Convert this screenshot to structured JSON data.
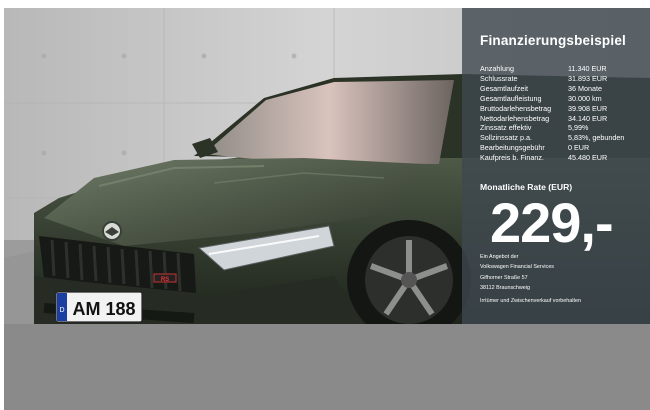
{
  "panel": {
    "title": "Finanzierungsbeispiel",
    "specs": [
      {
        "label": "Anzahlung",
        "value": "11.340 EUR"
      },
      {
        "label": "Schlussrate",
        "value": "31.893 EUR"
      },
      {
        "label": "Gesamtlaufzeit",
        "value": "36 Monate"
      },
      {
        "label": "Gesamtlaufleistung",
        "value": "30.000 km"
      },
      {
        "label": "Bruttodarlehensbetrag",
        "value": "39.908 EUR"
      },
      {
        "label": "Nettodarlehensbetrag",
        "value": "34.140 EUR"
      },
      {
        "label": "Zinssatz effektiv",
        "value": "5,99%"
      },
      {
        "label": "Sollzinssatz p.a.",
        "value": "5,83%, gebunden"
      },
      {
        "label": "Bearbeitungsgebühr",
        "value": "0 EUR"
      },
      {
        "label": "Kaufpreis b. Finanz.",
        "value": "45.480 EUR"
      }
    ],
    "rate_label": "Monatliche Rate (EUR)",
    "rate_value": "229,-",
    "offer_lines": [
      "Ein Angebot der",
      "Volkswagen Financial Services",
      "Gifhorner Straße 57",
      "38112 Braunschweig"
    ],
    "disclaimer": "Irrtümer und Zwischenverkauf vorbehalten"
  },
  "car": {
    "plate_country": "D",
    "plate_text": "AM 188",
    "badge_text": "RS"
  },
  "colors": {
    "panel_bg": "#3e4850",
    "car_body": "#3a4434",
    "wall": "#c9c9c9",
    "bottom_band": "#8a8a8a"
  }
}
